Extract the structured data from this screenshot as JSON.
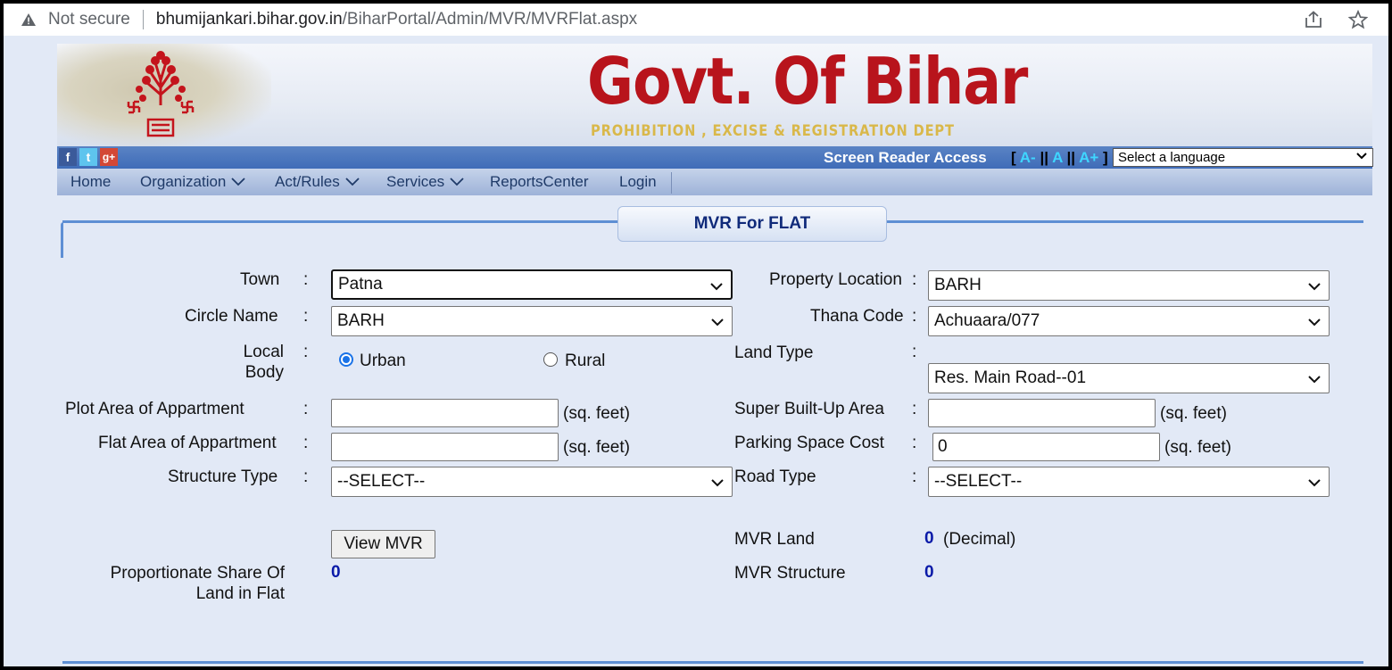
{
  "browser": {
    "security_label": "Not secure",
    "url_host": "bhumijankari.bihar.gov.in",
    "url_path": "/BiharPortal/Admin/MVR/MVRFlat.aspx"
  },
  "header": {
    "title": "Govt. Of Bihar",
    "department": "PROHIBITION , EXCISE & REGISTRATION DEPT",
    "screen_reader": "Screen Reader Access",
    "font_open": "[",
    "font_small": "A-",
    "font_sep1": "||",
    "font_normal": "A",
    "font_sep2": "||",
    "font_large": "A+",
    "font_close": "]",
    "language_select": "Select a language"
  },
  "menu": {
    "items": [
      "Home",
      "Organization",
      "Act/Rules",
      "Services",
      "ReportsCenter",
      "Login"
    ]
  },
  "form": {
    "title": "MVR For FLAT",
    "colon": ":",
    "town_label": "Town",
    "town_value": "Patna",
    "property_location_label": "Property Location",
    "property_location_value": "BARH",
    "circle_name_label": "Circle Name",
    "circle_name_value": "BARH",
    "thana_code_label": "Thana Code",
    "thana_code_value": "Achuaara/077",
    "local_body_label_line1": "Local",
    "local_body_label_line2": "Body",
    "radio_urban": "Urban",
    "radio_rural": "Rural",
    "selected_local_body": "Urban",
    "land_type_label": "Land Type",
    "land_type_value": "Res. Main Road--01",
    "plot_area_label": "Plot Area of Appartment",
    "plot_area_value": "",
    "super_builtup_label": "Super Built-Up Area",
    "super_builtup_value": "",
    "flat_area_label": "Flat Area of Appartment",
    "flat_area_value": "",
    "parking_cost_label": "Parking Space Cost",
    "parking_cost_value": "0",
    "unit_sqft": "(sq. feet)",
    "structure_type_label": "Structure Type",
    "structure_type_value": "--SELECT--",
    "road_type_label": "Road Type",
    "road_type_value": "--SELECT--",
    "view_button": "View MVR",
    "mvr_land_label": "MVR Land",
    "mvr_land_value": "0",
    "mvr_land_unit": "(Decimal)",
    "proportionate_label_line1": "Proportionate Share Of",
    "proportionate_label_line2": "Land in Flat",
    "proportionate_value": "0",
    "mvr_structure_label": "MVR Structure",
    "mvr_structure_value": "0"
  },
  "colors": {
    "title_red": "#b8141c",
    "dept_gold": "#d9b84a",
    "menu_text": "#1f3a68",
    "value_blue": "#0a1aa8",
    "panel_line": "#5e8fd4"
  }
}
